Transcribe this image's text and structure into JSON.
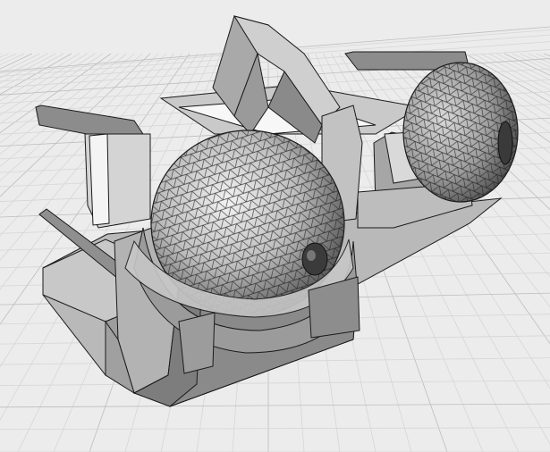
{
  "viewport": {
    "view_mode": "wireframe-shaded",
    "projection": "perspective",
    "grid_visible": true
  },
  "scene": {
    "model": "animatronic-eye-mechanism",
    "eyeball_count": 2
  },
  "colors": {
    "background": "#ececec",
    "grid_minor": "#d6d6d6",
    "grid_major": "#bdbdbd",
    "mesh_fill_light": "#d9d9d9",
    "mesh_fill_mid": "#a6a6a6",
    "mesh_fill_dark": "#5e5e5e",
    "edge": "#1a1a1a"
  }
}
